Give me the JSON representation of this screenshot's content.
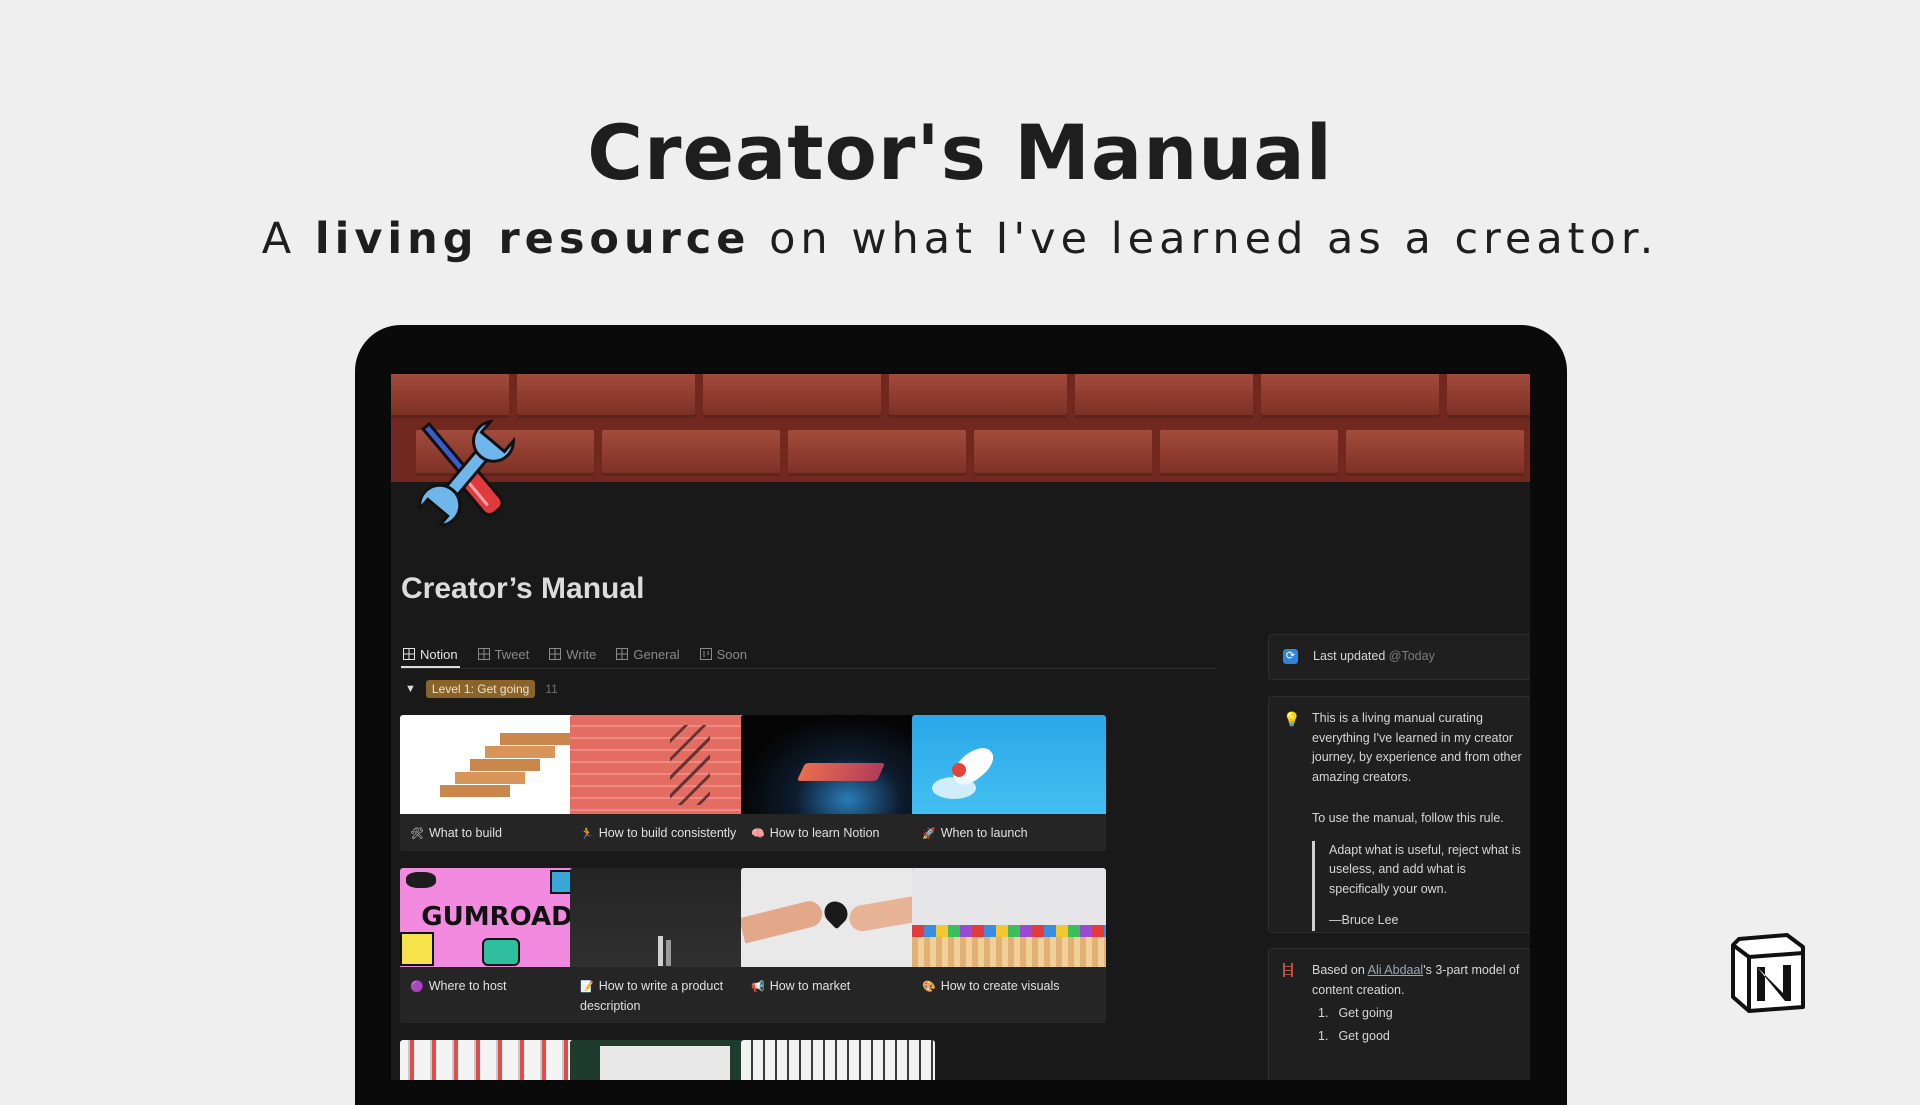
{
  "hero": {
    "title": "Creator's Manual",
    "subtitle_pre": "A ",
    "subtitle_bold": "living resource",
    "subtitle_post": " on what I've learned as a creator."
  },
  "page": {
    "title": "Creator’s Manual",
    "icon": "tools-icon",
    "cover": "brick-wall"
  },
  "tabs": [
    {
      "label": "Notion",
      "active": true
    },
    {
      "label": "Tweet",
      "active": false
    },
    {
      "label": "Write",
      "active": false
    },
    {
      "label": "General",
      "active": false
    },
    {
      "label": "Soon",
      "active": false
    }
  ],
  "group": {
    "label": "Level 1: Get going",
    "count": "11",
    "color": "#89632a"
  },
  "cards": [
    {
      "label": "What to build",
      "emoji": "🛠"
    },
    {
      "label": "How to build consistently",
      "emoji": "🏃"
    },
    {
      "label": "How to learn Notion",
      "emoji": "🧠"
    },
    {
      "label": "When to launch",
      "emoji": "🚀"
    },
    {
      "label": "Where to host",
      "emoji": "🟣"
    },
    {
      "label": "How to write a product description",
      "emoji": "📝"
    },
    {
      "label": "How to market",
      "emoji": "📢"
    },
    {
      "label": "How to create visuals",
      "emoji": "🎨"
    }
  ],
  "gumroad_text": "GUMROAD",
  "sidebar": {
    "last_updated_label": "Last updated",
    "last_updated_value": "@Today",
    "intro": "This is a living manual curating everything I've learned in my creator journey, by experience and from other amazing creators.",
    "rule_intro": "To use the manual, follow this rule.",
    "quote": "Adapt what is useful, reject what is useless, and add what is specifically your own.",
    "quote_author": "—Bruce Lee",
    "based_on_pre": "Based on ",
    "based_on_link": "Ali Abdaal",
    "based_on_post": "'s 3-part model of content creation.",
    "list": [
      "Get going",
      "Get good"
    ],
    "list_nums": [
      "1.",
      "1."
    ]
  },
  "colors": {
    "page_bg": "#efefef",
    "notion_dark": "#191919",
    "brick": "#8c3a2d",
    "accent_tag": "#89632a"
  }
}
